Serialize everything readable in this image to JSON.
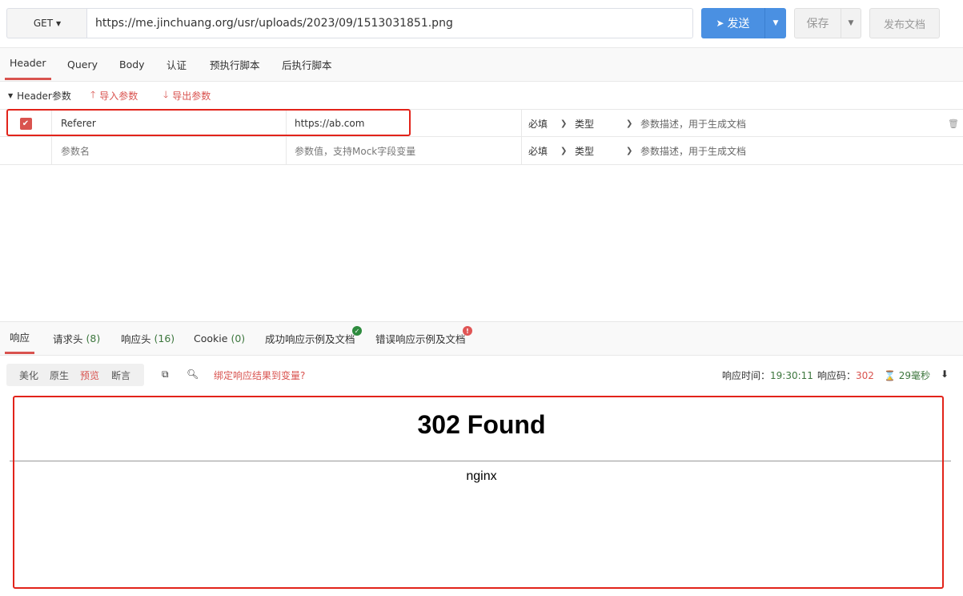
{
  "toolbar": {
    "method": "GET",
    "url": "https://me.jinchuang.org/usr/uploads/2023/09/1513031851.png",
    "send_label": "发送",
    "save_label": "保存",
    "publish_label": "发布文档"
  },
  "request_tabs": [
    "Header",
    "Query",
    "Body",
    "认证",
    "预执行脚本",
    "后执行脚本"
  ],
  "params_toolbar": {
    "section_label": "Header参数",
    "import_label": "导入参数",
    "export_label": "导出参数"
  },
  "params": {
    "rows": [
      {
        "checked": true,
        "name": "Referer",
        "value": "https://ab.com",
        "required": "必填",
        "type": "类型",
        "description": "参数描述，用于生成文档"
      }
    ],
    "new_row": {
      "name_placeholder": "参数名",
      "value_placeholder": "参数值，支持Mock字段变量",
      "required": "必填",
      "type": "类型",
      "description": "参数描述，用于生成文档"
    }
  },
  "response_tabs": {
    "response": "响应",
    "req_headers": "请求头",
    "req_headers_count": "(8)",
    "res_headers": "响应头",
    "res_headers_count": "(16)",
    "cookie": "Cookie",
    "cookie_count": "(0)",
    "success_example": "成功响应示例及文档",
    "error_example": "错误响应示例及文档"
  },
  "response_toolbar": {
    "view_modes": [
      "美化",
      "原生",
      "预览",
      "断言"
    ],
    "active_mode": "预览",
    "bind_var_label": "绑定响应结果到变量?",
    "time_label": "响应时间：",
    "time_value": "19:30:11",
    "code_label": "响应码：",
    "code_value": "302",
    "duration_value": "29毫秒"
  },
  "preview": {
    "title": "302 Found",
    "server": "nginx"
  },
  "colors": {
    "accent": "#d9534f",
    "primary": "#4a90e2",
    "highlight_box": "#e2231a"
  }
}
